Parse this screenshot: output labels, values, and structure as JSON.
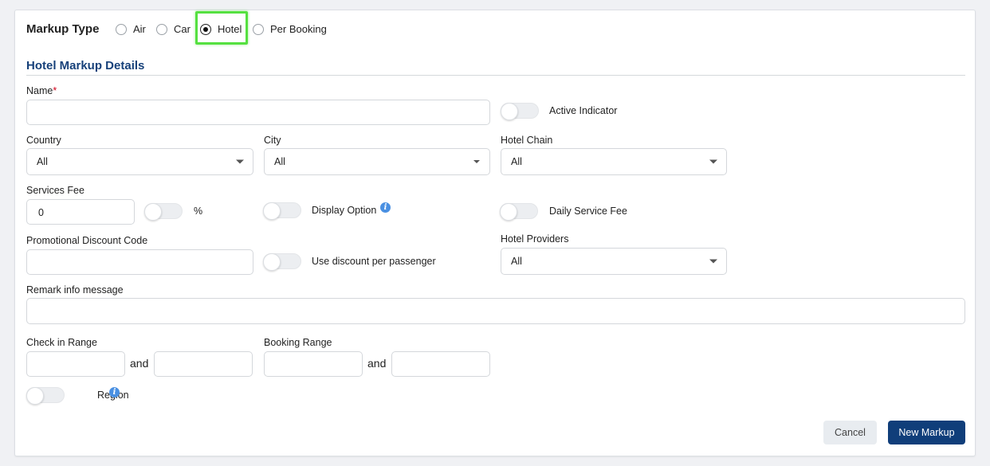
{
  "markup_type": {
    "title": "Markup Type",
    "options": [
      "Air",
      "Car",
      "Hotel",
      "Per Booking"
    ],
    "selected": "Hotel"
  },
  "section_title": "Hotel Markup Details",
  "fields": {
    "name_label": "Name",
    "name_required": "*",
    "name_value": "",
    "active_indicator_label": "Active Indicator",
    "country_label": "Country",
    "country_value": "All",
    "city_label": "City",
    "city_value": "All",
    "hotel_chain_label": "Hotel Chain",
    "hotel_chain_value": "All",
    "services_fee_label": "Services Fee",
    "services_fee_value": "0",
    "percent_label": "%",
    "display_option_label": "Display Option",
    "daily_service_fee_label": "Daily Service Fee",
    "promo_label": "Promotional Discount Code",
    "promo_value": "",
    "use_discount_label": "Use discount per passenger",
    "hotel_providers_label": "Hotel Providers",
    "hotel_providers_value": "All",
    "remark_label": "Remark info message",
    "remark_value": "",
    "checkin_label": "Check in Range",
    "booking_label": "Booking Range",
    "and_text": "and",
    "region_label": "Region"
  },
  "buttons": {
    "cancel": "Cancel",
    "new_markup": "New Markup"
  },
  "colors": {
    "accent": "#103e7a",
    "section_title": "#17417a",
    "highlight": "#55e040",
    "info_icon": "#4a90e2",
    "required": "#d0021b"
  }
}
